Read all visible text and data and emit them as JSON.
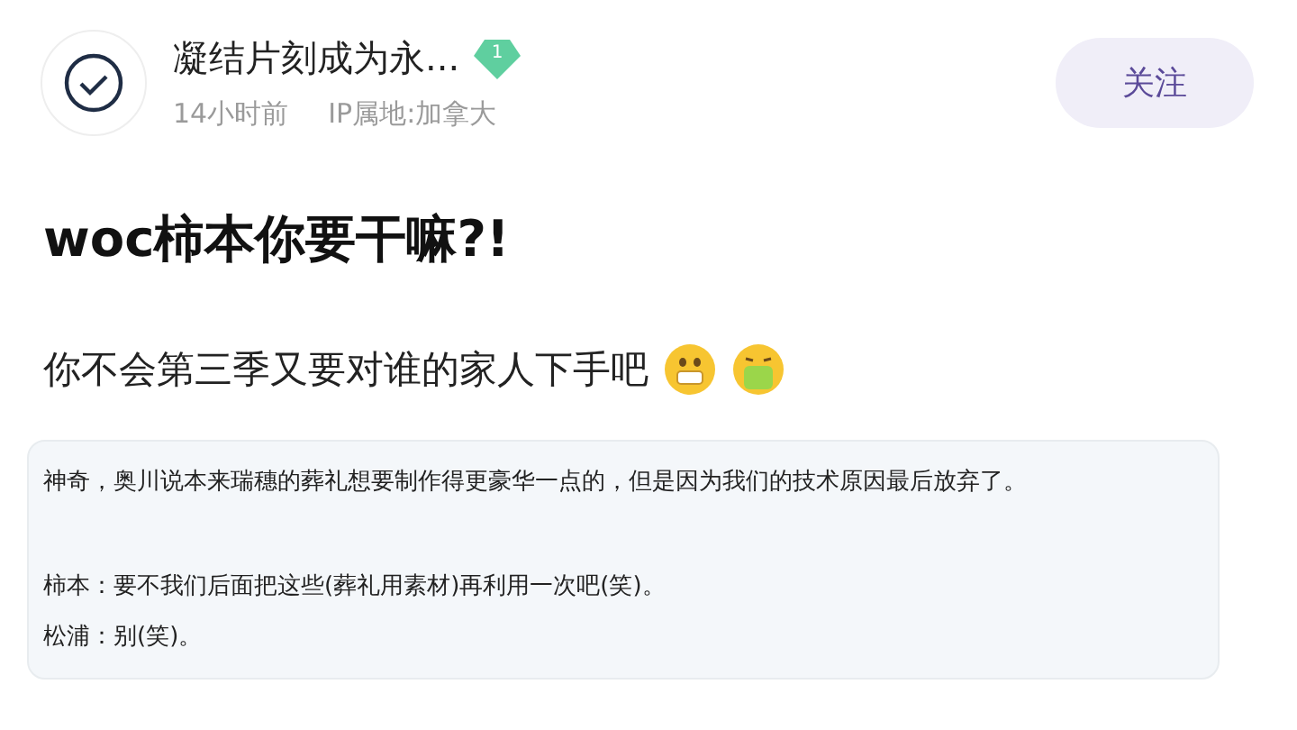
{
  "author": {
    "name": "凝结片刻成为永...",
    "level_badge": "1",
    "time": "14小时前",
    "ip_location": "IP属地:加拿大"
  },
  "follow_button": {
    "label": "关注"
  },
  "post": {
    "title": "woc柿本你要干嘛?!",
    "body": "你不会第三季又要对谁的家人下手吧",
    "emojis": [
      {
        "kind": "scared"
      },
      {
        "kind": "sick"
      }
    ],
    "quote_paragraphs": [
      [
        "神奇，奥川说本来瑞穗的葬礼想要制作得更豪华一点的，但是因为我们的技术原因最后放弃了。"
      ],
      [
        "柿本：要不我们后面把这些(葬礼用素材)再利用一次吧(笑)。",
        "松浦：别(笑)。"
      ]
    ]
  }
}
